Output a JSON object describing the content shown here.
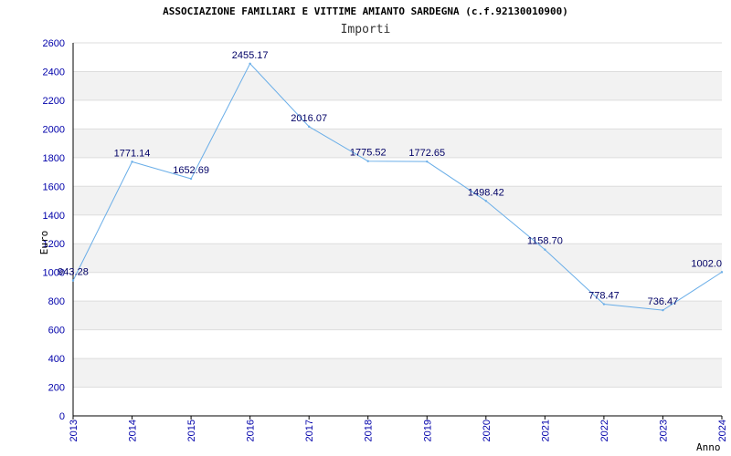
{
  "chart_data": {
    "type": "line",
    "title": "ASSOCIAZIONE FAMILIARI E VITTIME AMIANTO SARDEGNA (c.f.92130010900)",
    "subtitle": "Importi",
    "xlabel": "Anno",
    "ylabel": "Euro",
    "ylim": [
      0,
      2600
    ],
    "yticks": [
      0,
      200,
      400,
      600,
      800,
      1000,
      1200,
      1400,
      1600,
      1800,
      2000,
      2200,
      2400,
      2600
    ],
    "x": [
      "2013",
      "2014",
      "2015",
      "2016",
      "2017",
      "2018",
      "2019",
      "2020",
      "2021",
      "2022",
      "2023",
      "2024"
    ],
    "values": [
      943.28,
      1771.14,
      1652.69,
      2455.17,
      2016.07,
      1775.52,
      1772.65,
      1498.42,
      1158.7,
      778.47,
      736.47,
      1002.0
    ],
    "labels": [
      "943.28",
      "1771.14",
      "1652.69",
      "2455.17",
      "2016.07",
      "1775.52",
      "1772.65",
      "1498.42",
      "1158.70",
      "778.47",
      "736.47",
      "1002.0"
    ],
    "grid": true,
    "colors": {
      "line": "#6aaee8",
      "band": "#f2f2f2",
      "grid": "#dddddd",
      "tick_text": "#0000aa",
      "label_text": "#000066"
    }
  }
}
